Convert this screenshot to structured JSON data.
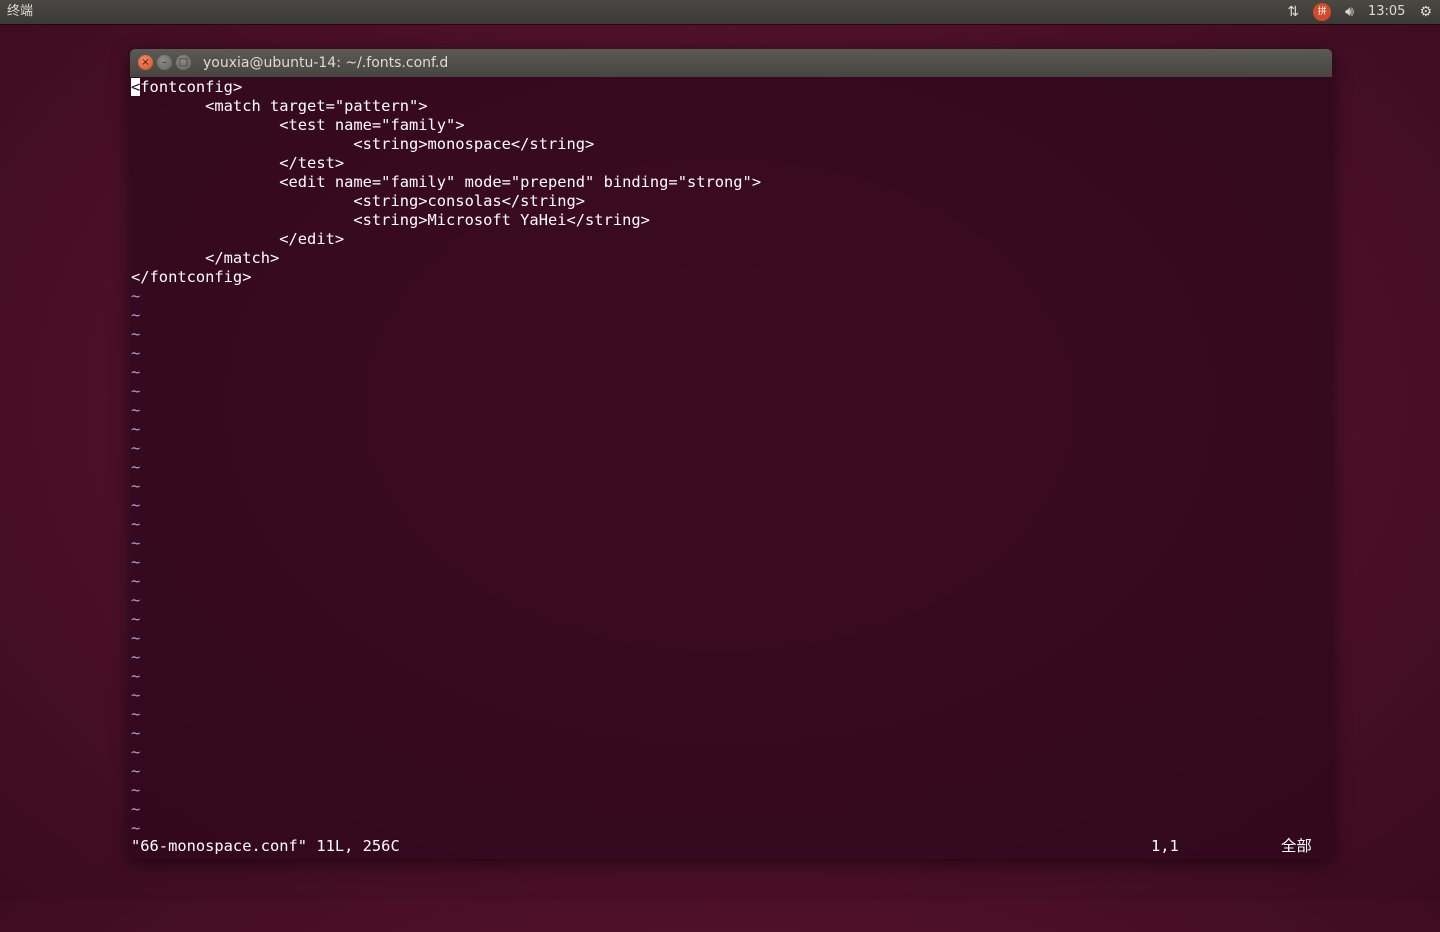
{
  "top_panel": {
    "app_title": "终端",
    "clock": "13:05",
    "icons": [
      "network-updown-icon",
      "input-method-icon",
      "volume-icon",
      "power-gear-icon"
    ],
    "ime_label": "拼"
  },
  "window": {
    "title": "youxia@ubuntu-14: ~/.fonts.conf.d",
    "buttons": {
      "close": "×",
      "minimize": "–",
      "maximize": "□"
    }
  },
  "editor": {
    "first_char": "<",
    "first_line_rest": "fontconfig>",
    "lines": [
      "        <match target=\"pattern\">",
      "                <test name=\"family\">",
      "                        <string>monospace</string>",
      "                </test>",
      "                <edit name=\"family\" mode=\"prepend\" binding=\"strong\">",
      "                        <string>consolas</string>",
      "                        <string>Microsoft YaHei</string>",
      "                </edit>",
      "        </match>",
      "</fontconfig>"
    ],
    "tilde": "~",
    "tilde_count": 29
  },
  "status": {
    "file_info": "\"66-monospace.conf\" 11L, 256C",
    "cursor_pos": "1,1",
    "range": "全部"
  },
  "colors": {
    "terminal_bg": "#30081e",
    "tilde": "#a9a4d8",
    "close_button": "#d24d24"
  }
}
